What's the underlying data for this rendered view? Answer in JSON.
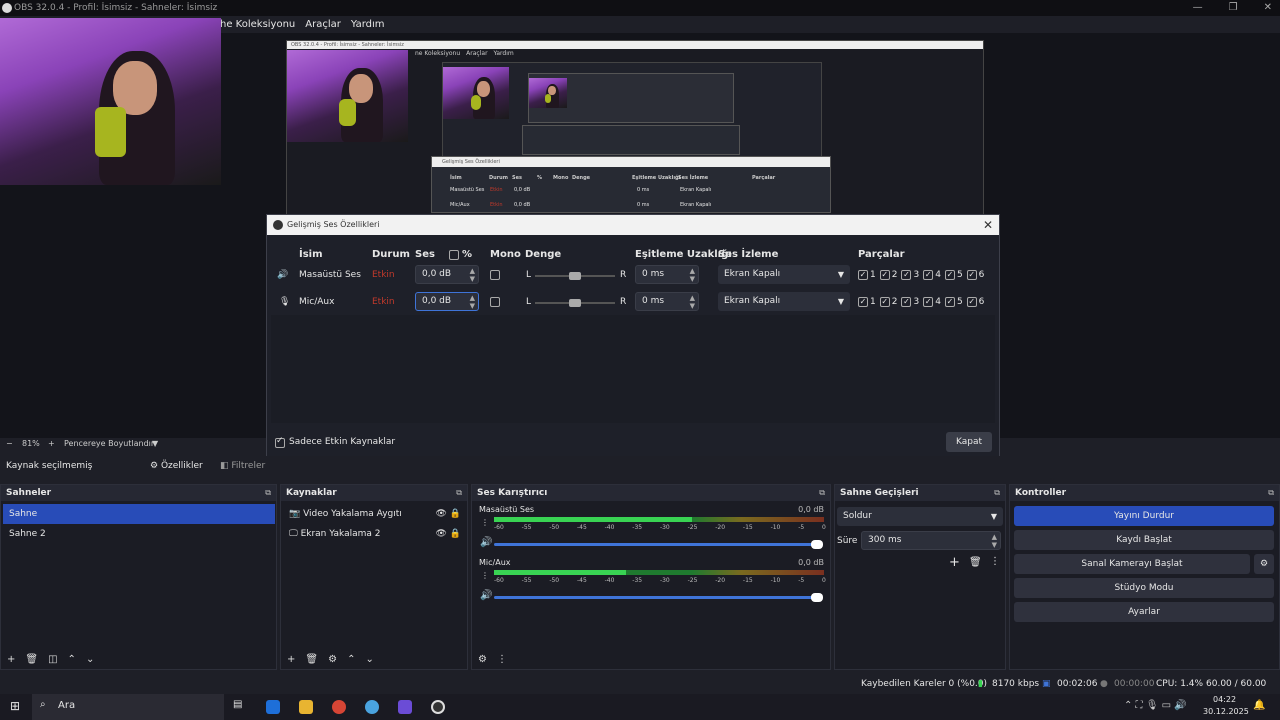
{
  "window": {
    "title": "OBS 32.0.4 - Profil: İsimsiz - Sahneler: İsimsiz",
    "controls": [
      "—",
      "❐",
      "✕"
    ]
  },
  "menu": [
    "he Koleksiyonu",
    "Araçlar",
    "Yardım"
  ],
  "nested_titles": {
    "shot1": "OBS 32.0.4 - Profil: İsimsiz - Sahneler: İsimsiz",
    "shot1_menu": [
      "ne Koleksiyonu",
      "Araçlar",
      "Yardım"
    ],
    "nested_dialog": "Gelişmiş Ses Özellikleri"
  },
  "nested_dialog": {
    "headers": [
      "İsim",
      "Durum",
      "Ses",
      "%",
      "Mono",
      "Denge",
      "Eşitleme Uzaklığı",
      "Ses İzleme",
      "Parçalar"
    ],
    "rows": [
      {
        "name": "Masaüstü Ses",
        "status": "Etkin",
        "vol": "0,0 dB",
        "sync": "0 ms",
        "monitor": "Ekran Kapalı"
      },
      {
        "name": "Mic/Aux",
        "status": "Etkin",
        "vol": "0,0 dB",
        "sync": "0 ms",
        "monitor": "Ekran Kapalı"
      }
    ]
  },
  "dialog": {
    "title": "Gelişmiş Ses Özellikleri",
    "headers": {
      "name": "İsim",
      "status": "Durum",
      "volume": "Ses",
      "percent": "%",
      "mono": "Mono",
      "balance": "Denge",
      "sync": "Eşitleme Uzaklığı",
      "monitor": "Ses İzleme",
      "tracks": "Parçalar"
    },
    "rows": [
      {
        "name": "Masaüstü Ses",
        "status": "Etkin",
        "volume": "0,0 dB",
        "bal_l": "L",
        "bal_r": "R",
        "balance": 0.5,
        "sync": "0 ms",
        "monitor": "Ekran Kapalı",
        "tracks": [
          "1",
          "2",
          "3",
          "4",
          "5",
          "6"
        ]
      },
      {
        "name": "Mic/Aux",
        "status": "Etkin",
        "volume": "0,0 dB",
        "bal_l": "L",
        "bal_r": "R",
        "balance": 0.5,
        "sync": "0 ms",
        "monitor": "Ekran Kapalı",
        "tracks": [
          "1",
          "2",
          "3",
          "4",
          "5",
          "6"
        ]
      }
    ],
    "only_active": "Sadece Etkin Kaynaklar",
    "close": "Kapat"
  },
  "zoom": {
    "minus": "−",
    "value": "81%",
    "plus": "+",
    "fit": "Pencereye Boyutlandır"
  },
  "source_bar": {
    "none": "Kaynak seçilmemiş",
    "props": "Özellikler",
    "filters": "Filtreler"
  },
  "scenes": {
    "title": "Sahneler",
    "items": [
      "Sahne",
      "Sahne 2"
    ],
    "selected": 0
  },
  "sources": {
    "title": "Kaynaklar",
    "items": [
      "Video Yakalama Aygıtı",
      "Ekran Yakalama 2"
    ]
  },
  "mixer": {
    "title": "Ses Karıştırıcı",
    "scale": [
      "-60",
      "-55",
      "-50",
      "-45",
      "-40",
      "-35",
      "-30",
      "-25",
      "-20",
      "-15",
      "-10",
      "-5",
      "0"
    ],
    "channels": [
      {
        "name": "Masaüstü Ses",
        "db": "0,0 dB",
        "level": 0.6,
        "volume": 1.0
      },
      {
        "name": "Mic/Aux",
        "db": "0,0 dB",
        "level": 0.4,
        "volume": 1.0
      }
    ]
  },
  "transitions": {
    "title": "Sahne Geçişleri",
    "type": "Soldur",
    "duration_label": "Süre",
    "duration": "300 ms"
  },
  "controls": {
    "title": "Kontroller",
    "buttons": [
      "Yayını Durdur",
      "Kaydı Başlat",
      "Sanal Kamerayı Başlat",
      "Stüdyo Modu",
      "Ayarlar"
    ]
  },
  "status": {
    "dropped": "Kaybedilen Kareler 0 (%0.0)",
    "bitrate": "8170 kbps",
    "live": "00:02:06",
    "rec": "00:00:00",
    "cpu": "CPU: 1.4%",
    "fps": "60.00 / 60.00 FPS"
  },
  "taskbar": {
    "search": "Ara",
    "time": "04:22",
    "date": "30.12.2025"
  },
  "colors": {
    "accent": "#284cb8",
    "active_status": "#c0392b",
    "meter_green": "#39d353"
  }
}
